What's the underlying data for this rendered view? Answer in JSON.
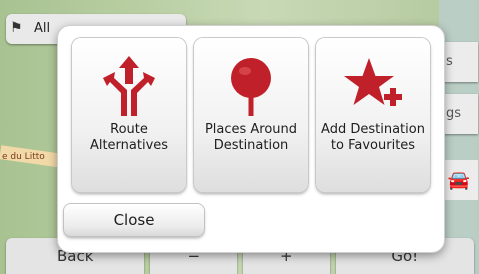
{
  "background": {
    "top_label": "All",
    "road_label": "e du Litto",
    "right_buttons": [
      "s",
      "gs"
    ],
    "bottom_buttons": {
      "back": "Back",
      "minus": "−",
      "plus": "+",
      "go": "Go!"
    }
  },
  "dialog": {
    "options": [
      {
        "label_line1": "Route",
        "label_line2": "Alternatives",
        "icon": "route-alternatives-icon"
      },
      {
        "label_line1": "Places Around",
        "label_line2": "Destination",
        "icon": "places-pin-icon"
      },
      {
        "label_line1": "Add Destination",
        "label_line2": "to Favourites",
        "icon": "star-add-icon"
      }
    ],
    "close_label": "Close"
  },
  "colors": {
    "accent": "#c0202a",
    "tile_top": "#ffffff",
    "tile_bottom": "#dedede"
  }
}
